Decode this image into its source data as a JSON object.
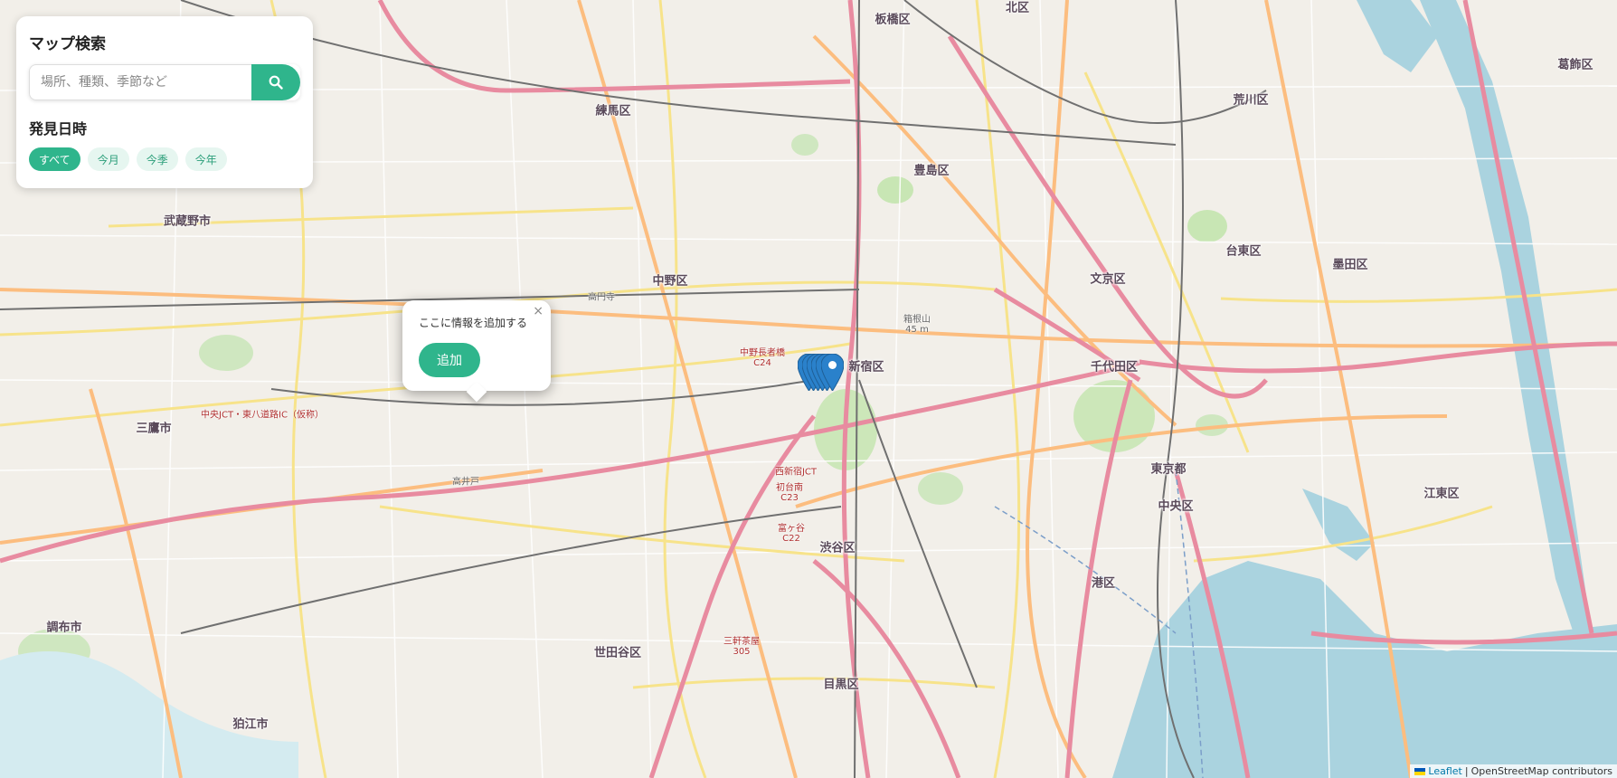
{
  "search_panel": {
    "title": "マップ検索",
    "search_placeholder": "場所、種類、季節など",
    "search_icon": "search-icon",
    "date_section_title": "発見日時",
    "filters": [
      {
        "label": "すべて",
        "active": true
      },
      {
        "label": "今月",
        "active": false
      },
      {
        "label": "今季",
        "active": false
      },
      {
        "label": "今年",
        "active": false
      }
    ]
  },
  "popup": {
    "close_label": "×",
    "text": "ここに情報を追加する",
    "add_label": "追加"
  },
  "map": {
    "labels": {
      "itabashi": "板橋区",
      "kita": "北区",
      "nerima": "練馬区",
      "arakawa": "荒川区",
      "katsushika": "葛飾区",
      "toshima": "豊島区",
      "musashino": "武蔵野市",
      "taito": "台東区",
      "sumida": "墨田区",
      "nakano": "中野区",
      "bunkyo": "文京区",
      "shinjuku": "新宿区",
      "chiyoda": "千代田区",
      "mitaka": "三鷹市",
      "tokyo": "東京都",
      "chuo": "中央区",
      "koto": "江東区",
      "shibuya": "渋谷区",
      "minato": "港区",
      "chofu": "調布市",
      "setagaya": "世田谷区",
      "meguro": "目黒区",
      "komae": "狛江市"
    },
    "small_labels": {
      "koenji": "高円寺",
      "hakoneyama": "箱根山\n45 m",
      "nakano_choja": "中野長者橋\nC24",
      "nishi_shinjuku": "西新宿JCT",
      "hatsudai": "初台南\nC23",
      "tomigaya": "富ヶ谷\nC22",
      "takaido": "高井戸",
      "chuo_jct": "中央JCT・東八道路IC（仮称）",
      "sangenjaya": "三軒茶屋\n305"
    },
    "marker_color": "#2a81cb",
    "accent_color": "#2fb58c"
  },
  "attribution": {
    "leaflet": "Leaflet",
    "separator": " | ",
    "osm": "OpenStreetMap contributors"
  }
}
